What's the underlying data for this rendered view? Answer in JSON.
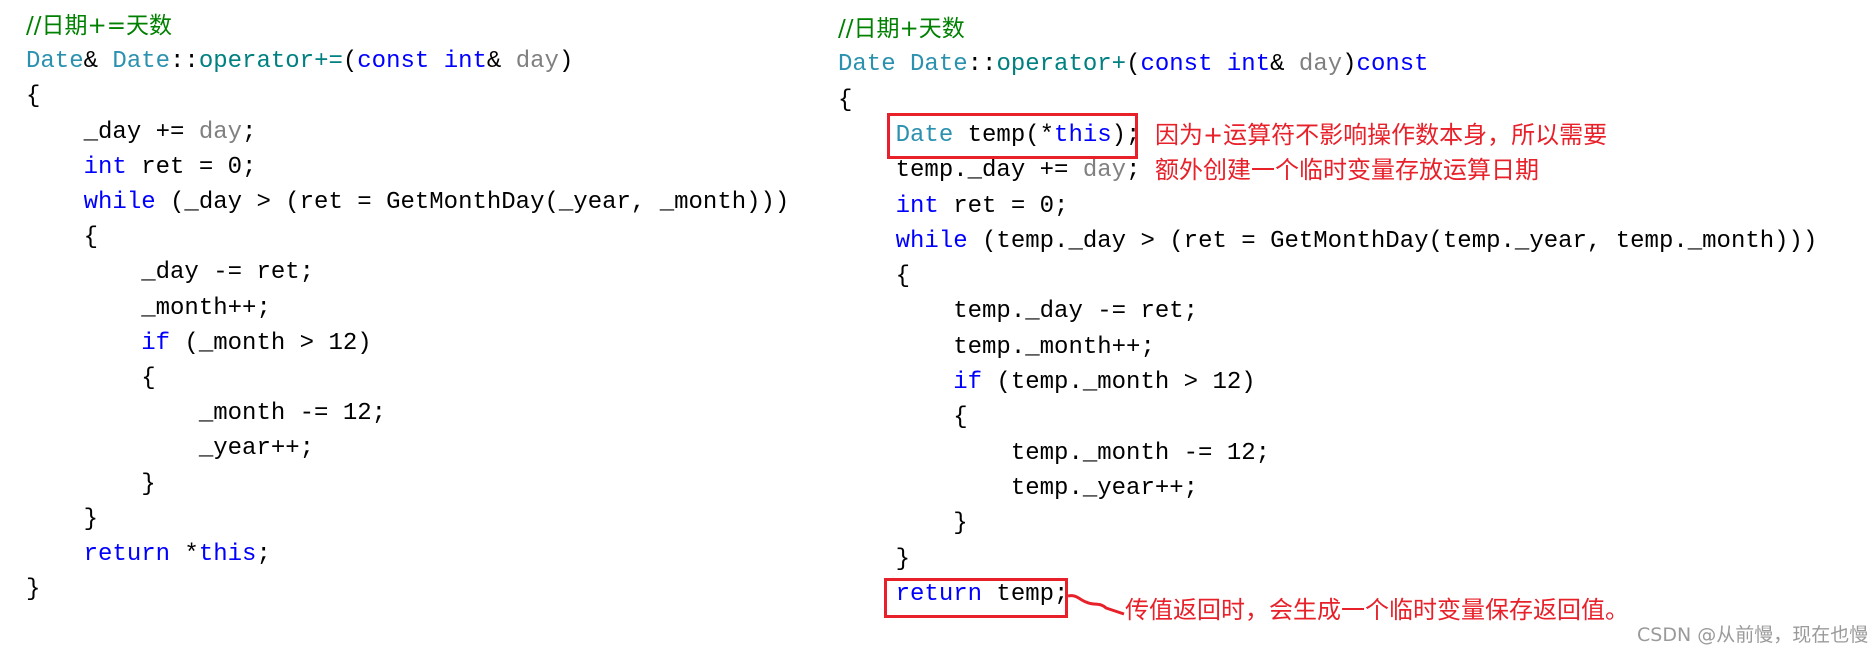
{
  "colors": {
    "keyword": "#0000ff",
    "type": "#2b91af",
    "param": "#808080",
    "comment": "#008000",
    "annotation": "#e8202a"
  },
  "left_code": [
    [
      [
        "cm",
        "//日期+=天数"
      ]
    ],
    [
      [
        "ty",
        "Date"
      ],
      [
        "",
        "& "
      ],
      [
        "ty",
        "Date"
      ],
      [
        "",
        "::"
      ],
      [
        "op",
        "operator+="
      ],
      [
        "",
        "("
      ],
      [
        "kw",
        "const"
      ],
      [
        "",
        " "
      ],
      [
        "kw",
        "int"
      ],
      [
        "",
        "& "
      ],
      [
        "pa",
        "day"
      ],
      [
        "",
        ")"
      ]
    ],
    [
      [
        "",
        "{"
      ]
    ],
    [
      [
        "",
        "    _day += "
      ],
      [
        "pa",
        "day"
      ],
      [
        "",
        ";"
      ]
    ],
    [
      [
        "",
        "    "
      ],
      [
        "kw",
        "int"
      ],
      [
        "",
        " ret = 0;"
      ]
    ],
    [
      [
        "",
        "    "
      ],
      [
        "kw",
        "while"
      ],
      [
        "",
        " (_day > (ret = GetMonthDay(_year, _month)))"
      ]
    ],
    [
      [
        "",
        "    {"
      ]
    ],
    [
      [
        "",
        "        _day -= ret;"
      ]
    ],
    [
      [
        "",
        "        _month++;"
      ]
    ],
    [
      [
        "",
        "        "
      ],
      [
        "kw",
        "if"
      ],
      [
        "",
        " (_month > 12)"
      ]
    ],
    [
      [
        "",
        "        {"
      ]
    ],
    [
      [
        "",
        "            _month -= 12;"
      ]
    ],
    [
      [
        "",
        "            _year++;"
      ]
    ],
    [
      [
        "",
        "        }"
      ]
    ],
    [
      [
        "",
        "    }"
      ]
    ],
    [
      [
        "",
        "    "
      ],
      [
        "kw",
        "return"
      ],
      [
        "",
        " *"
      ],
      [
        "kw",
        "this"
      ],
      [
        "",
        ";"
      ]
    ],
    [
      [
        "",
        "}"
      ]
    ]
  ],
  "right_code": [
    [
      [
        "cm",
        "//日期+天数"
      ]
    ],
    [
      [
        "ty",
        "Date"
      ],
      [
        "",
        " "
      ],
      [
        "ty",
        "Date"
      ],
      [
        "",
        "::"
      ],
      [
        "op",
        "operator+"
      ],
      [
        "",
        "("
      ],
      [
        "kw",
        "const"
      ],
      [
        "",
        " "
      ],
      [
        "kw",
        "int"
      ],
      [
        "",
        "& "
      ],
      [
        "pa",
        "day"
      ],
      [
        "",
        ")"
      ],
      [
        "kw",
        "const"
      ]
    ],
    [
      [
        "",
        "{"
      ]
    ],
    [
      [
        "",
        "    "
      ],
      [
        "ty",
        "Date"
      ],
      [
        "",
        " temp(*"
      ],
      [
        "kw",
        "this"
      ],
      [
        "",
        ");"
      ]
    ],
    [
      [
        "",
        "    temp._day += "
      ],
      [
        "pa",
        "day"
      ],
      [
        "",
        ";"
      ]
    ],
    [
      [
        "",
        "    "
      ],
      [
        "kw",
        "int"
      ],
      [
        "",
        " ret = 0;"
      ]
    ],
    [
      [
        "",
        "    "
      ],
      [
        "kw",
        "while"
      ],
      [
        "",
        " (temp._day > (ret = GetMonthDay(temp._year, temp._month)))"
      ]
    ],
    [
      [
        "",
        "    {"
      ]
    ],
    [
      [
        "",
        "        temp._day -= ret;"
      ]
    ],
    [
      [
        "",
        "        temp._month++;"
      ]
    ],
    [
      [
        "",
        "        "
      ],
      [
        "kw",
        "if"
      ],
      [
        "",
        " (temp._month > 12)"
      ]
    ],
    [
      [
        "",
        "        {"
      ]
    ],
    [
      [
        "",
        "            temp._month -= 12;"
      ]
    ],
    [
      [
        "",
        "            temp._year++;"
      ]
    ],
    [
      [
        "",
        "        }"
      ]
    ],
    [
      [
        "",
        "    }"
      ]
    ],
    [
      [
        "",
        "    "
      ],
      [
        "kw",
        "return"
      ],
      [
        "",
        " temp;"
      ]
    ]
  ],
  "annotations": {
    "note1_line1": "因为+运算符不影响操作数本身，所以需要",
    "note1_line2": "额外创建一个临时变量存放运算日期",
    "note2": "传值返回时，会生成一个临时变量保存返回值。"
  },
  "watermark": "CSDN @从前慢，现在也慢"
}
